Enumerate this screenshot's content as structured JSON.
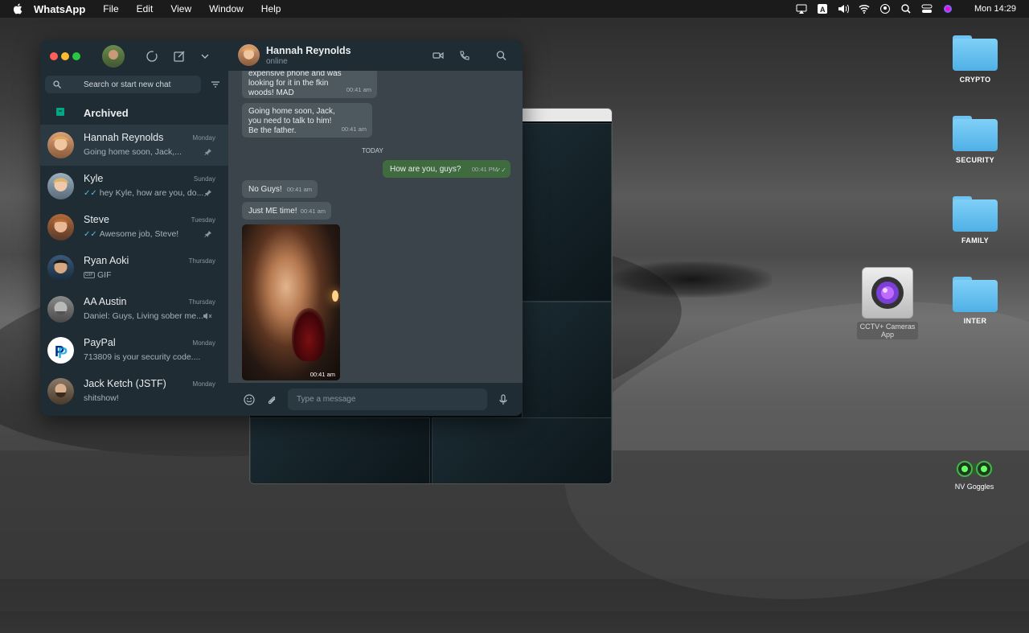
{
  "menubar": {
    "app": "WhatsApp",
    "items": [
      "File",
      "Edit",
      "View",
      "Window",
      "Help"
    ],
    "clock": "Mon 14:29"
  },
  "desktop": {
    "folders": [
      "CRYPTO",
      "SECURITY",
      "FAMILY",
      "INTER"
    ],
    "cctv_app": "CCTV+ Cameras App",
    "goggles": "NV Goggles"
  },
  "sidebar": {
    "search_placeholder": "Search or start new chat",
    "archived": "Archived",
    "chats": [
      {
        "name": "Hannah Reynolds",
        "time": "Monday",
        "preview": "Going home soon, Jack,...",
        "pinned": true,
        "ticks": false
      },
      {
        "name": "Kyle",
        "time": "Sunday",
        "preview": "hey Kyle, how are you, do...",
        "pinned": true,
        "ticks": true
      },
      {
        "name": "Steve",
        "time": "Tuesday",
        "preview": "Awesome job, Steve!",
        "pinned": true,
        "ticks": true
      },
      {
        "name": "Ryan Aoki",
        "time": "Thursday",
        "preview": "GIF",
        "pinned": false,
        "ticks": false
      },
      {
        "name": "AA Austin",
        "time": "Thursday",
        "preview": "Daniel: Guys, Living sober me...",
        "pinned": false,
        "ticks": false
      },
      {
        "name": "PayPal",
        "time": "Monday",
        "preview": "713809 is your security code....",
        "pinned": false,
        "ticks": false
      },
      {
        "name": "Jack Ketch (JSTF)",
        "time": "Monday",
        "preview": "shitshow!",
        "pinned": false,
        "ticks": false
      }
    ]
  },
  "conversation": {
    "contact": "Hannah Reynolds",
    "status": "online",
    "messages": [
      {
        "lines": [
          "expensive phone and was",
          "looking for it in the fkin",
          "woods! MAD"
        ],
        "time": "00:41 am"
      },
      {
        "lines": [
          "Going home soon, Jack,",
          "you need to talk to him!",
          "Be the father."
        ],
        "time": "00:41 am"
      },
      {
        "lines": [
          "How are you, guys?"
        ],
        "time": "00:41 PM"
      },
      {
        "lines": [
          "No Guys!"
        ],
        "time": "00:41 am"
      },
      {
        "lines": [
          "Just ME time!"
        ],
        "time": "00:41 am"
      }
    ],
    "day_label": "TODAY",
    "photo_time": "00:41 am",
    "composer_placeholder": "Type a message"
  }
}
